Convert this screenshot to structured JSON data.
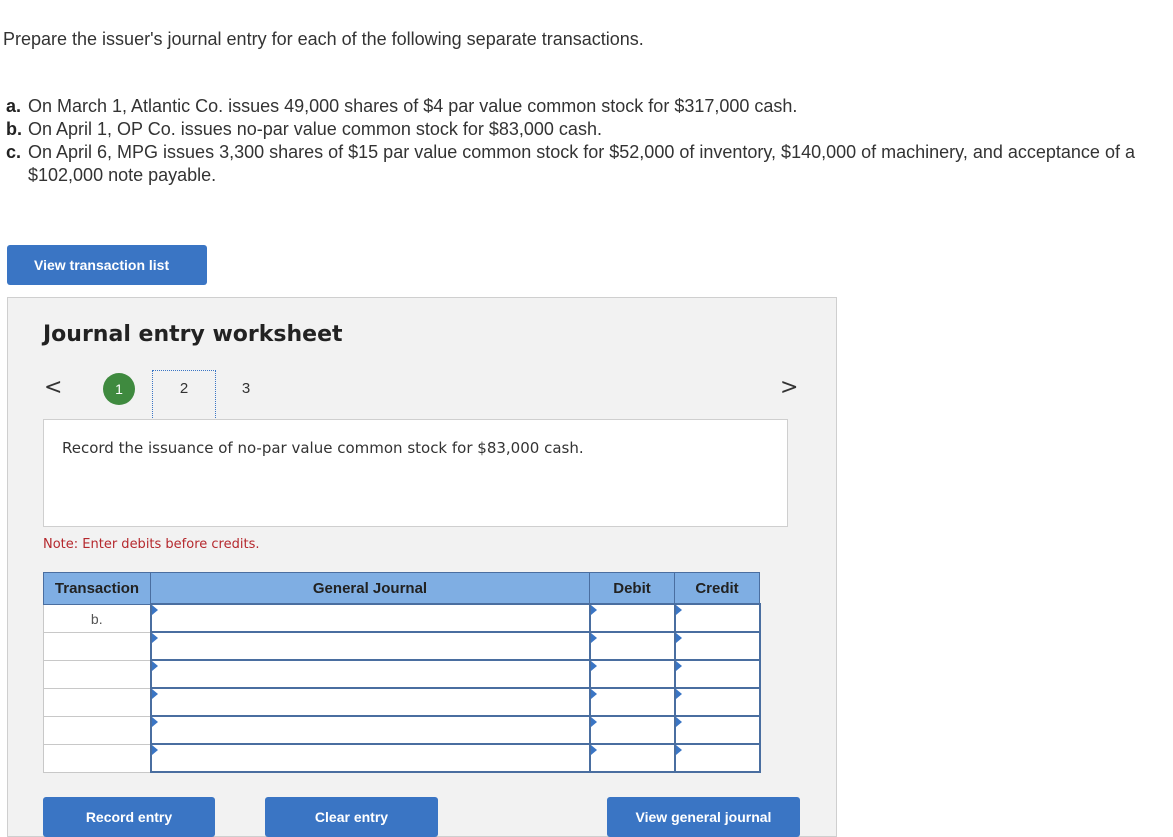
{
  "intro": "Prepare the issuer's journal entry for each of the following separate transactions.",
  "transactions": [
    {
      "letter": "a.",
      "text": "On March 1, Atlantic Co. issues 49,000 shares of $4 par value common stock for $317,000 cash."
    },
    {
      "letter": "b.",
      "text": "On April 1, OP Co. issues no-par value common stock for $83,000 cash."
    },
    {
      "letter": "c.",
      "text": "On April 6, MPG issues 3,300 shares of $15 par value common stock for $52,000 of inventory, $140,000 of machinery, and acceptance of a $102,000 note payable."
    }
  ],
  "view_transaction_list": "View transaction list",
  "worksheet": {
    "title": "Journal entry worksheet",
    "nav": {
      "prev": "<",
      "next": ">",
      "steps": [
        "1",
        "2",
        "3"
      ],
      "completed_step": "1",
      "current_step": "2"
    },
    "prompt": "Record the issuance of no-par value common stock for $83,000 cash.",
    "note": "Note: Enter debits before credits.",
    "table": {
      "headers": [
        "Transaction",
        "General Journal",
        "Debit",
        "Credit"
      ],
      "rows": [
        {
          "transaction": "b.",
          "account": "",
          "debit": "",
          "credit": ""
        },
        {
          "transaction": "",
          "account": "",
          "debit": "",
          "credit": ""
        },
        {
          "transaction": "",
          "account": "",
          "debit": "",
          "credit": ""
        },
        {
          "transaction": "",
          "account": "",
          "debit": "",
          "credit": ""
        },
        {
          "transaction": "",
          "account": "",
          "debit": "",
          "credit": ""
        },
        {
          "transaction": "",
          "account": "",
          "debit": "",
          "credit": ""
        }
      ]
    },
    "buttons": {
      "record_entry": "Record entry",
      "clear_entry": "Clear entry",
      "view_general_journal": "View general journal"
    }
  },
  "colors": {
    "button": "#3a75c4",
    "table_header": "#7faee3",
    "completed_step": "#3f8a3f",
    "note": "#b5282d",
    "worksheet_bg": "#f2f2f2"
  }
}
